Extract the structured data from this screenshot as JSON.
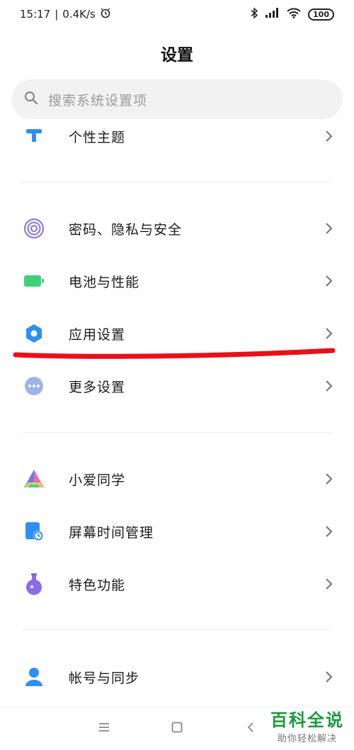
{
  "status": {
    "time": "15:17",
    "speed": "0.4K/s",
    "battery": "100"
  },
  "header": {
    "title": "设置"
  },
  "search": {
    "placeholder": "搜索系统设置项"
  },
  "items": [
    {
      "label": "个性主题"
    },
    {
      "label": "密码、隐私与安全"
    },
    {
      "label": "电池与性能"
    },
    {
      "label": "应用设置"
    },
    {
      "label": "更多设置"
    },
    {
      "label": "小爱同学"
    },
    {
      "label": "屏幕时间管理"
    },
    {
      "label": "特色功能"
    },
    {
      "label": "帐号与同步"
    }
  ],
  "colors": {
    "accent_blue": "#2f8ff0",
    "battery_green": "#3ed07a",
    "annotation_red": "#e8101a"
  },
  "watermark": {
    "title": "百科全说",
    "subtitle": "助你轻松解决"
  }
}
